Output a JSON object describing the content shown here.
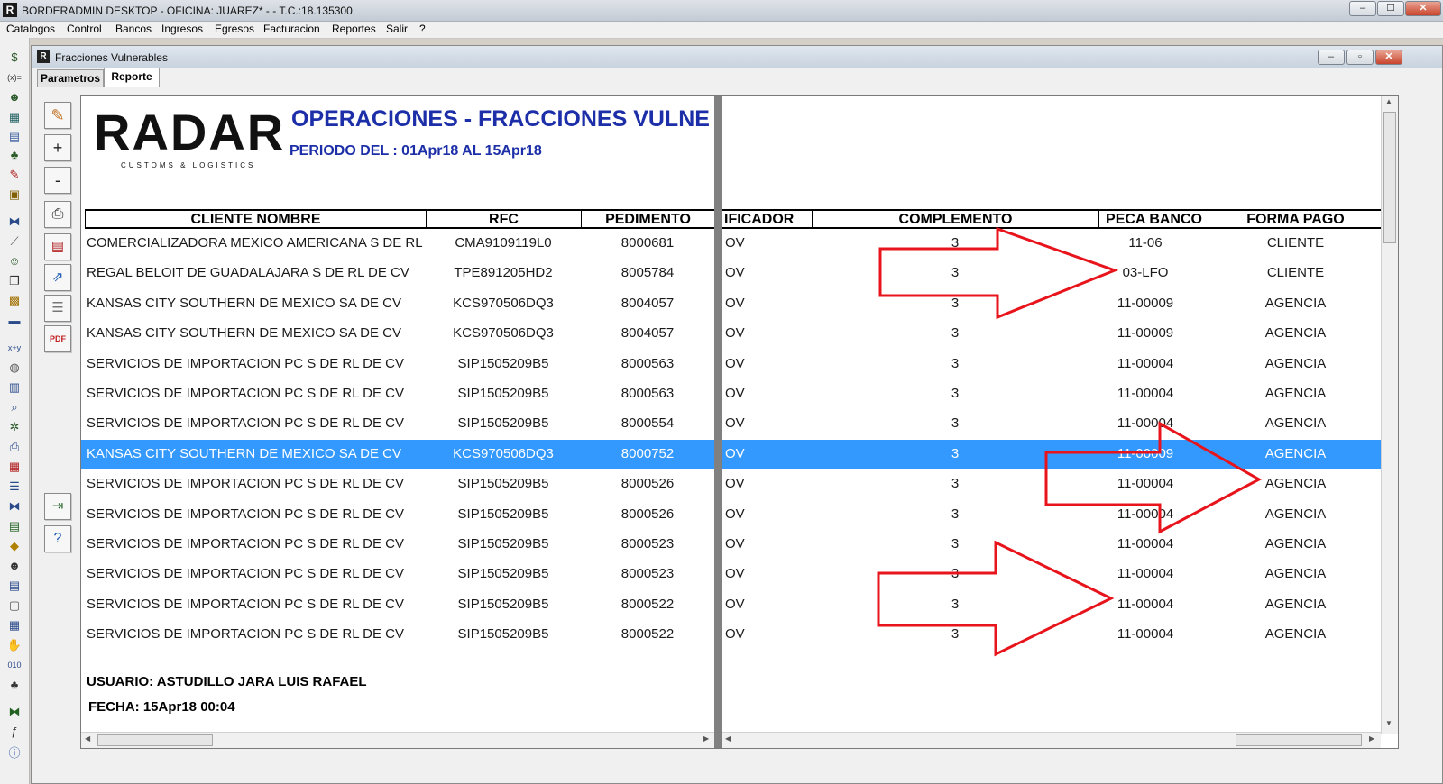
{
  "window": {
    "title": "BORDERADMIN DESKTOP - OFICINA: JUAREZ* -  - T.C.:18.135300",
    "min": "–",
    "max": "☐",
    "close": "✕"
  },
  "menu": [
    "Catalogos",
    "Control",
    "Bancos",
    "Ingresos",
    "Egresos",
    "Facturacion",
    "Reportes",
    "Salir",
    "?"
  ],
  "child_window": {
    "title": "Fracciones Vulnerables",
    "min": "–",
    "max": "▫",
    "close": "✕"
  },
  "tabs": [
    "Parametros",
    "Reporte"
  ],
  "side_buttons": {
    "zoom_in": "+",
    "zoom_out": "-"
  },
  "report": {
    "logo_text": "RADAR",
    "logo_sub": "CUSTOMS & LOGISTICS",
    "title": "OPERACIONES - FRACCIONES VULNE",
    "periodo": "PERIODO DEL : 01Apr18 AL 15Apr18",
    "columns": [
      "CLIENTE NOMBRE",
      "RFC",
      "PEDIMENTO",
      "IFICADOR",
      "COMPLEMENTO",
      "PECA BANCO",
      "FORMA PAGO"
    ],
    "rows": [
      {
        "cliente": "COMERCIALIZADORA MEXICO AMERICANA S DE RL",
        "rfc": "CMA9109119L0",
        "pedimento": "8000681",
        "ificador": "OV",
        "complemento": "3",
        "peca": "11-06",
        "forma": "CLIENTE"
      },
      {
        "cliente": "REGAL BELOIT DE GUADALAJARA S DE RL DE CV",
        "rfc": "TPE891205HD2",
        "pedimento": "8005784",
        "ificador": "OV",
        "complemento": "3",
        "peca": "03-LFO",
        "forma": "CLIENTE"
      },
      {
        "cliente": "KANSAS CITY SOUTHERN DE MEXICO SA DE CV",
        "rfc": "KCS970506DQ3",
        "pedimento": "8004057",
        "ificador": "OV",
        "complemento": "3",
        "peca": "11-00009",
        "forma": "AGENCIA"
      },
      {
        "cliente": "KANSAS CITY SOUTHERN DE MEXICO SA DE CV",
        "rfc": "KCS970506DQ3",
        "pedimento": "8004057",
        "ificador": "OV",
        "complemento": "3",
        "peca": "11-00009",
        "forma": "AGENCIA"
      },
      {
        "cliente": "SERVICIOS DE IMPORTACION PC S DE RL DE CV",
        "rfc": "SIP1505209B5",
        "pedimento": "8000563",
        "ificador": "OV",
        "complemento": "3",
        "peca": "11-00004",
        "forma": "AGENCIA"
      },
      {
        "cliente": "SERVICIOS DE IMPORTACION PC S DE RL DE CV",
        "rfc": "SIP1505209B5",
        "pedimento": "8000563",
        "ificador": "OV",
        "complemento": "3",
        "peca": "11-00004",
        "forma": "AGENCIA"
      },
      {
        "cliente": "SERVICIOS DE IMPORTACION PC S DE RL DE CV",
        "rfc": "SIP1505209B5",
        "pedimento": "8000554",
        "ificador": "OV",
        "complemento": "3",
        "peca": "11-00004",
        "forma": "AGENCIA"
      },
      {
        "cliente": "KANSAS CITY SOUTHERN DE MEXICO SA DE CV",
        "rfc": "KCS970506DQ3",
        "pedimento": "8000752",
        "ificador": "OV",
        "complemento": "3",
        "peca": "11-00009",
        "forma": "AGENCIA"
      },
      {
        "cliente": "SERVICIOS DE IMPORTACION PC S DE RL DE CV",
        "rfc": "SIP1505209B5",
        "pedimento": "8000526",
        "ificador": "OV",
        "complemento": "3",
        "peca": "11-00004",
        "forma": "AGENCIA"
      },
      {
        "cliente": "SERVICIOS DE IMPORTACION PC S DE RL DE CV",
        "rfc": "SIP1505209B5",
        "pedimento": "8000526",
        "ificador": "OV",
        "complemento": "3",
        "peca": "11-00004",
        "forma": "AGENCIA"
      },
      {
        "cliente": "SERVICIOS DE IMPORTACION PC S DE RL DE CV",
        "rfc": "SIP1505209B5",
        "pedimento": "8000523",
        "ificador": "OV",
        "complemento": "3",
        "peca": "11-00004",
        "forma": "AGENCIA"
      },
      {
        "cliente": "SERVICIOS DE IMPORTACION PC S DE RL DE CV",
        "rfc": "SIP1505209B5",
        "pedimento": "8000523",
        "ificador": "OV",
        "complemento": "3",
        "peca": "11-00004",
        "forma": "AGENCIA"
      },
      {
        "cliente": "SERVICIOS DE IMPORTACION PC S DE RL DE CV",
        "rfc": "SIP1505209B5",
        "pedimento": "8000522",
        "ificador": "OV",
        "complemento": "3",
        "peca": "11-00004",
        "forma": "AGENCIA"
      },
      {
        "cliente": "SERVICIOS DE IMPORTACION PC S DE RL DE CV",
        "rfc": "SIP1505209B5",
        "pedimento": "8000522",
        "ificador": "OV",
        "complemento": "3",
        "peca": "11-00004",
        "forma": "AGENCIA"
      }
    ],
    "selected_row": 7,
    "usuario": "USUARIO: ASTUDILLO JARA LUIS RAFAEL",
    "fecha": "FECHA: 15Apr18 00:04"
  },
  "colors": {
    "title_blue": "#1c2fa8",
    "selection": "#3399ff",
    "arrow_red": "#e8141c"
  }
}
